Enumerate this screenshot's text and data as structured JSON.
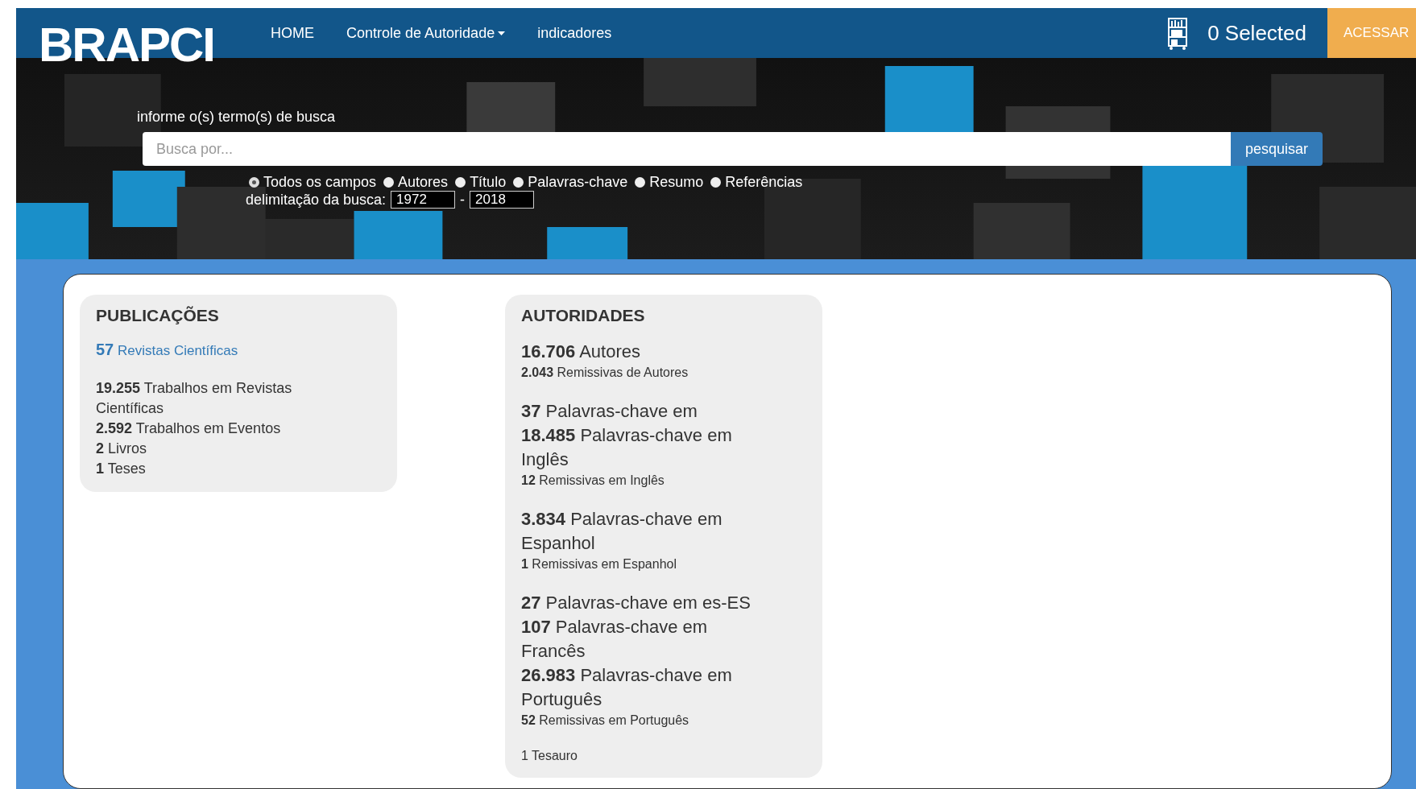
{
  "navbar": {
    "logo": "BRAPCI",
    "links": [
      {
        "label": "HOME",
        "dropdown": false
      },
      {
        "label": "Controle de Autoridade",
        "dropdown": true
      },
      {
        "label": "indicadores",
        "dropdown": false
      }
    ],
    "selected_count": "0 Selected",
    "login_button": "ACESSAR"
  },
  "search": {
    "label": "informe o(s) termo(s) de busca",
    "placeholder": "Busca por...",
    "button": "pesquisar",
    "fields": [
      {
        "label": "Todos os campos",
        "selected": true
      },
      {
        "label": "Autores",
        "selected": false
      },
      {
        "label": "Título",
        "selected": false
      },
      {
        "label": "Palavras-chave",
        "selected": false
      },
      {
        "label": "Resumo",
        "selected": false
      },
      {
        "label": "Referências",
        "selected": false
      }
    ],
    "range_label": "delimitação da busca:",
    "year_from": "1972",
    "separator": "-",
    "year_to": "2018"
  },
  "panels": [
    {
      "title": "PUBLICAÇÕES",
      "groups": [
        [
          {
            "kind": "link",
            "text": "**57** Revistas Científicas"
          }
        ],
        [
          {
            "kind": "item",
            "text": "**19.255** Trabalhos em Revistas Científicas"
          },
          {
            "kind": "item",
            "text": "**2.592** Trabalhos em Eventos"
          },
          {
            "kind": "item",
            "text": "**2** Livros"
          },
          {
            "kind": "item",
            "text": "**1** Teses"
          }
        ]
      ]
    },
    {
      "title": "AUTORIDADES",
      "groups": [
        [
          {
            "kind": "main",
            "text": "**16.706** Autores"
          },
          {
            "kind": "sub",
            "text": "**2.043** Remissivas de Autores"
          }
        ],
        [
          {
            "kind": "main",
            "text": "**37** Palavras-chave em"
          },
          {
            "kind": "main",
            "text": "**18.485** Palavras-chave em Inglês"
          },
          {
            "kind": "sub",
            "text": "**12** Remissivas em Inglês"
          }
        ],
        [
          {
            "kind": "main",
            "text": "**3.834** Palavras-chave em Espanhol"
          },
          {
            "kind": "sub",
            "text": "**1** Remissivas em Espanhol"
          }
        ],
        [
          {
            "kind": "main",
            "text": "**27** Palavras-chave em es-ES"
          },
          {
            "kind": "main",
            "text": "**107** Palavras-chave em Francês"
          },
          {
            "kind": "main",
            "text": "**26.983** Palavras-chave em Português"
          },
          {
            "kind": "sub",
            "text": "**52** Remissivas em Português"
          }
        ],
        [
          {
            "kind": "sub",
            "text": "1 Tesauro"
          }
        ]
      ]
    }
  ]
}
